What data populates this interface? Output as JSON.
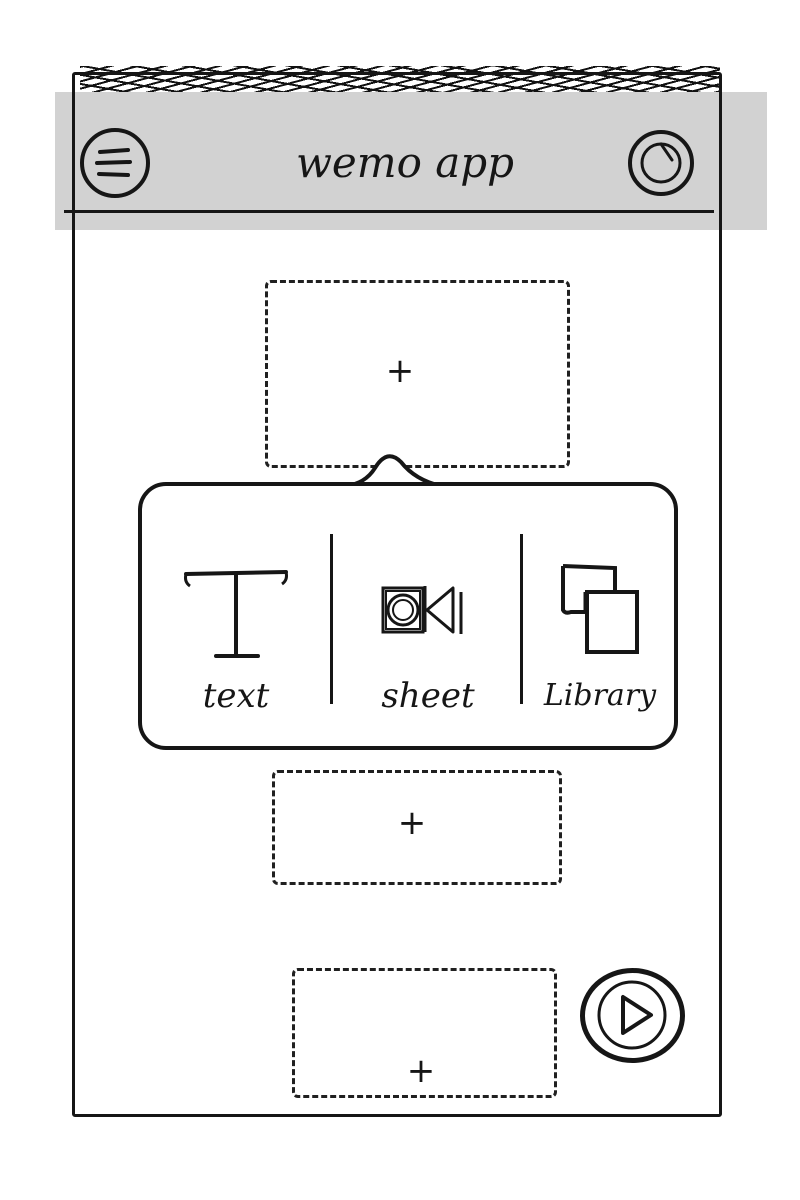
{
  "header": {
    "title": "wemo app",
    "menu_icon": "hamburger-menu-icon",
    "profile_icon": "profile-circle-icon",
    "background": "#d2d2d2"
  },
  "slots": [
    {
      "plus": "+"
    },
    {
      "plus": "+"
    },
    {
      "plus": "+"
    }
  ],
  "popover": {
    "options": [
      {
        "label": "text",
        "icon": "text-t-icon"
      },
      {
        "label": "sheet",
        "icon": "sheet-media-icon"
      },
      {
        "label": "Library",
        "icon": "library-layers-icon"
      }
    ]
  },
  "fab": {
    "icon": "play-icon"
  },
  "colors": {
    "ink": "#161616",
    "paper": "#ffffff"
  }
}
